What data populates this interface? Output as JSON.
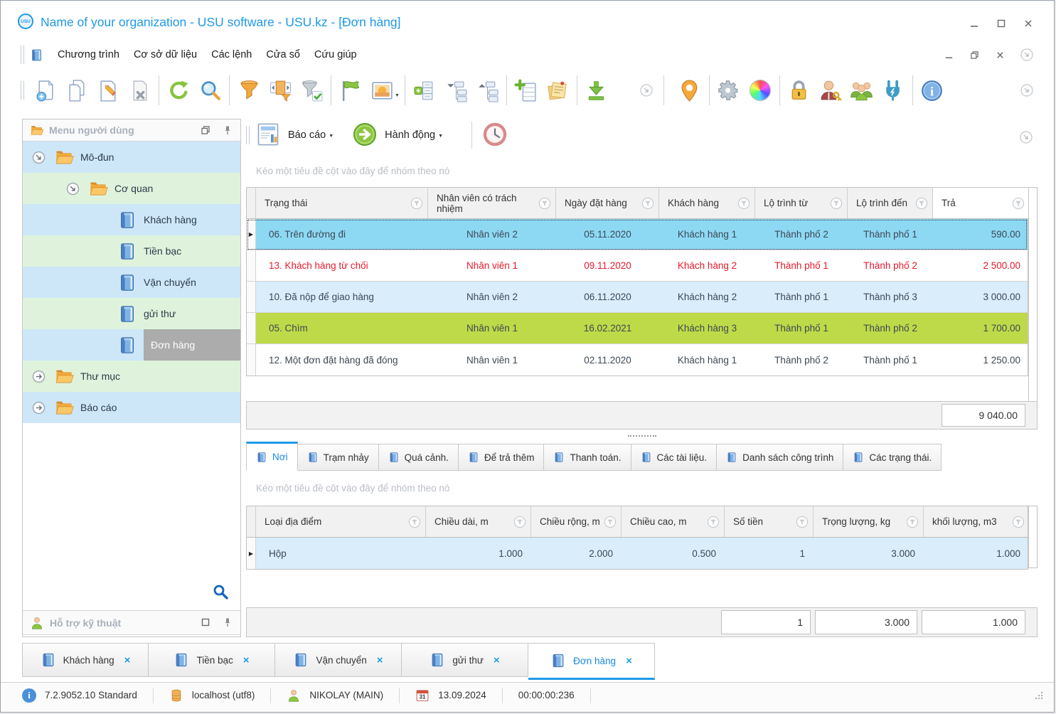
{
  "window": {
    "title": "Name of your organization - USU software - USU.kz - [Đơn hàng]",
    "logo_text": "USU"
  },
  "menu": {
    "items": [
      "Chương trình",
      "Cơ sở dữ liệu",
      "Các lệnh",
      "Cửa sổ",
      "Cứu giúp"
    ]
  },
  "toolbar": {
    "icons": [
      "new-document",
      "copy-document",
      "edit-document",
      "delete-document",
      "refresh",
      "search",
      "filter",
      "filter-panel",
      "filter-apply",
      "flag",
      "picture",
      "add-row",
      "tree-expand-down",
      "tree-expand-up",
      "add-table",
      "notes",
      "download",
      "more-chevron",
      "map-pin",
      "settings-gear",
      "color-wheel",
      "lock",
      "user-key",
      "users-group",
      "plug",
      "info",
      "more-chevron-right"
    ]
  },
  "sidebar": {
    "header": {
      "title": "Menu người dùng"
    },
    "tree": [
      {
        "label": "Mô-đun",
        "type": "folder",
        "state": "expanded"
      },
      {
        "label": "Cơ quan",
        "type": "folder",
        "state": "expanded"
      },
      {
        "label": "Khách hàng",
        "type": "book"
      },
      {
        "label": "Tiền bạc",
        "type": "book"
      },
      {
        "label": "Vận chuyển",
        "type": "book"
      },
      {
        "label": "gửi thư",
        "type": "book"
      },
      {
        "label": "Đơn hàng",
        "type": "book",
        "selected": true
      },
      {
        "label": "Thư mục",
        "type": "folder",
        "state": "collapsed"
      },
      {
        "label": "Báo cáo",
        "type": "folder",
        "state": "collapsed"
      }
    ],
    "support": {
      "title": "Hỗ trợ kỹ thuật"
    }
  },
  "actionbar": {
    "report_label": "Báo cáo",
    "action_label": "Hành động"
  },
  "main_grid": {
    "group_hint": "Kéo một tiêu đề cột vào đây để nhóm theo nó",
    "columns": [
      "Trạng thái",
      "Nhân viên có trách nhiệm",
      "Ngày đặt hàng",
      "Khách hàng",
      "Lộ trình từ",
      "Lộ trình đến",
      "Trả"
    ],
    "rows": [
      {
        "status": "06. Trên đường đi",
        "employee": "Nhân viên 2",
        "date": "05.11.2020",
        "customer": "Khách hàng 1",
        "from": "Thành phố 2",
        "to": "Thành phố 1",
        "pay": "590.00"
      },
      {
        "status": "13. Khách hàng từ chối",
        "employee": "Nhân viên 1",
        "date": "09.11.2020",
        "customer": "Khách hàng 2",
        "from": "Thành phố 1",
        "to": "Thành phố 2",
        "pay": "2 500.00"
      },
      {
        "status": "10. Đã nộp để giao hàng",
        "employee": "Nhân viên 2",
        "date": "06.11.2020",
        "customer": "Khách hàng 2",
        "from": "Thành phố 1",
        "to": "Thành phố 3",
        "pay": "3 000.00"
      },
      {
        "status": "05. Chìm",
        "employee": "Nhân viên 1",
        "date": "16.02.2021",
        "customer": "Khách hàng 3",
        "from": "Thành phố 1",
        "to": "Thành phố 2",
        "pay": "1 700.00"
      },
      {
        "status": "12. Một đơn đặt hàng đã đóng",
        "employee": "Nhân viên 1",
        "date": "02.11.2020",
        "customer": "Khách hàng 1",
        "from": "Thành phố 2",
        "to": "Thành phố 1",
        "pay": "1 250.00"
      }
    ],
    "total": "9 040.00"
  },
  "detail": {
    "tabs": [
      "Nơi",
      "Trạm nhảy",
      "Quá cảnh.",
      "Để trả thêm",
      "Thanh toán.",
      "Các tài liệu.",
      "Danh sách công trình",
      "Các trạng thái."
    ],
    "active_tab": "Nơi",
    "group_hint": "Kéo một tiêu đề cột vào đây để nhóm theo nó",
    "columns": [
      "Loại địa điểm",
      "Chiều dài, m",
      "Chiều rộng, m",
      "Chiều cao, m",
      "Số tiền",
      "Trọng lượng, kg",
      "khối lượng, m3"
    ],
    "rows": [
      {
        "type": "Hộp",
        "length": "1.000",
        "width": "2.000",
        "height": "0.500",
        "amount": "1",
        "weight": "3.000",
        "volume": "1.000"
      }
    ],
    "totals": {
      "amount": "1",
      "weight": "3.000",
      "volume": "1.000"
    }
  },
  "window_tabs": {
    "items": [
      "Khách hàng",
      "Tiền bạc",
      "Vận chuyển",
      "gửi thư",
      "Đơn hàng"
    ],
    "active": "Đơn hàng",
    "close_glyph": "×"
  },
  "statusbar": {
    "version": "7.2.9052.10 Standard",
    "database": "localhost (utf8)",
    "user": "NIKOLAY (MAIN)",
    "calendar_day": "31",
    "date": "13.09.2024",
    "timer": "00:00:00:236"
  },
  "colors": {
    "accent_blue": "#1e9ae8",
    "selected_row": "#8dd9f4",
    "light_blue_row": "#d9edfa",
    "green_row": "#bfda48",
    "red_text": "#e8192c",
    "tree_blue_stripe": "#cde7f8",
    "tree_green_stripe": "#dff3dc",
    "selected_tree_item": "#acacac"
  }
}
